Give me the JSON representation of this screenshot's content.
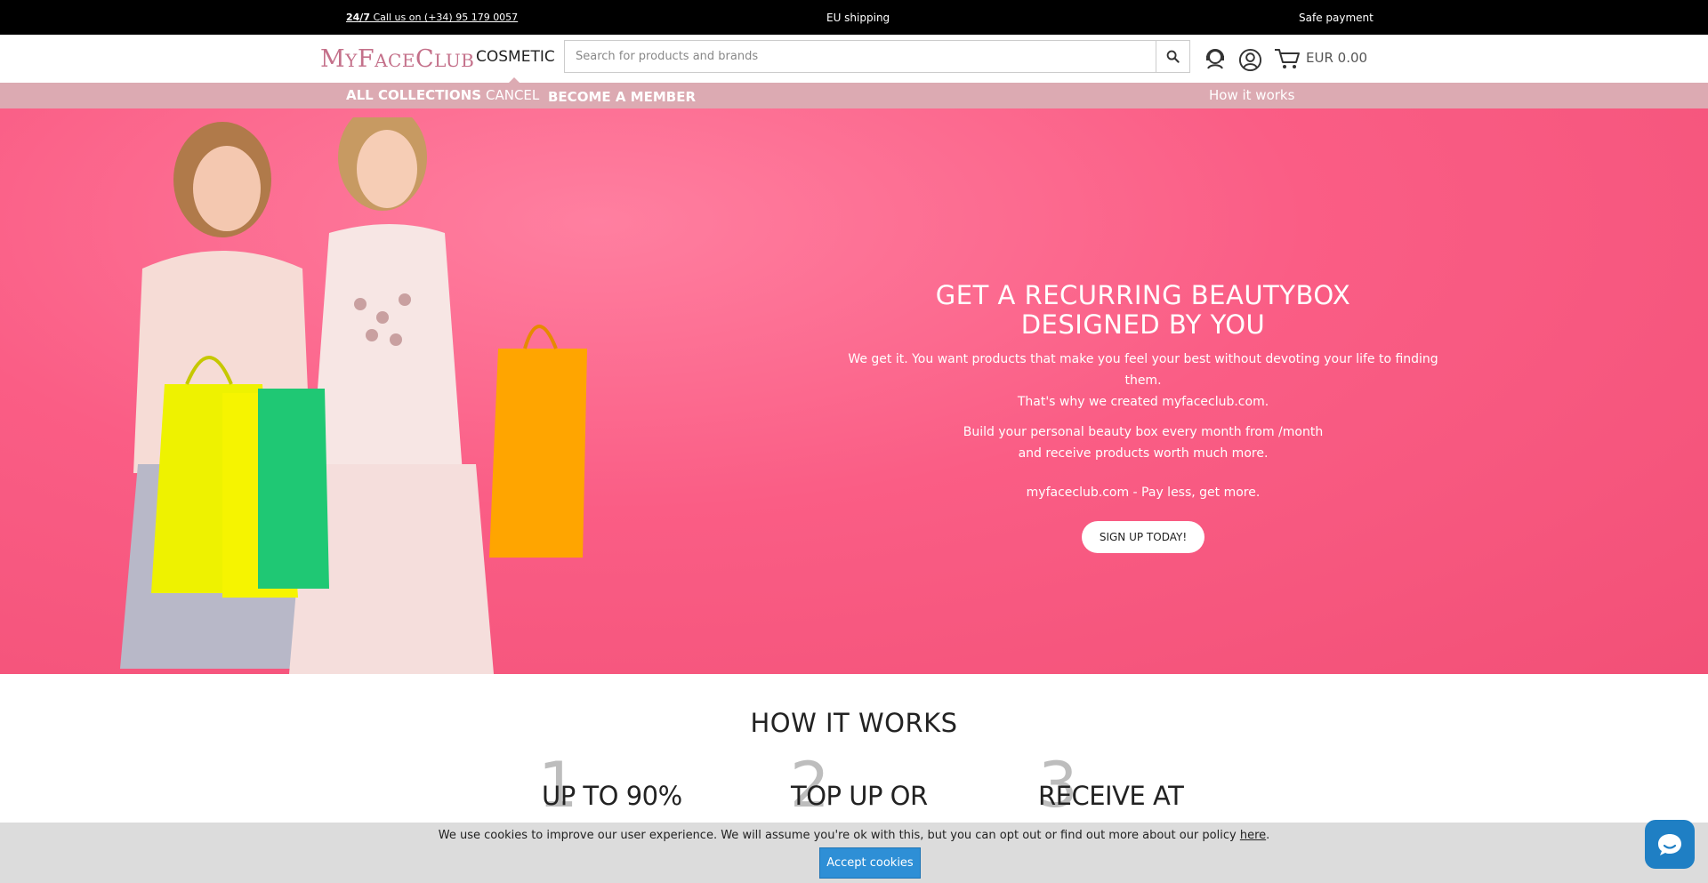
{
  "topbar": {
    "call_strong": "24/7",
    "call_text": " Call us on (+34) 95 179 0057",
    "shipping": "EU shipping",
    "payment": "Safe payment"
  },
  "header": {
    "logo": {
      "p1": "M",
      "p2": "Y",
      "p3": "F",
      "p4": "ACE",
      "p5": "C",
      "p6": "LUB"
    },
    "section": "COSMETIC",
    "search_placeholder": "Search for products and brands",
    "cart_total": "EUR 0.00"
  },
  "nav": {
    "all_collections": "ALL COLLECTIONS",
    "cancel": "CANCEL",
    "become_member": "BECOME A MEMBER",
    "how_it_works": "How it works"
  },
  "hero": {
    "title_line1": "GET A RECURRING BEAUTYBOX",
    "title_line2": "DESIGNED BY YOU",
    "p1_line1": "We get it. You want products that make you feel your best without devoting your life to finding them.",
    "p1_line2": "That's why we created myfaceclub.com.",
    "p2_line1": "Build your personal beauty box every month from /month",
    "p2_line2": "and receive products worth much more.",
    "tagline": "myfaceclub.com -  Pay less, get more.",
    "cta": "SIGN UP TODAY!"
  },
  "how": {
    "title": "HOW IT WORKS",
    "steps": [
      {
        "num": "1",
        "label": "UP TO 90%"
      },
      {
        "num": "2",
        "label": "TOP UP OR"
      },
      {
        "num": "3",
        "label": "RECEIVE AT"
      }
    ]
  },
  "cookie": {
    "message": "We use cookies to improve our user experience. We will assume you're ok with this, but you can opt out or find out more about our policy ",
    "link": "here",
    "end": ".",
    "accept": "Accept cookies"
  },
  "colors": {
    "topbar": "#000000",
    "nav": "#dcaab2",
    "hero": "#fa5d85",
    "logo": "#c4708a",
    "accept": "#2e8fd6",
    "chat": "#1f7fc4"
  }
}
